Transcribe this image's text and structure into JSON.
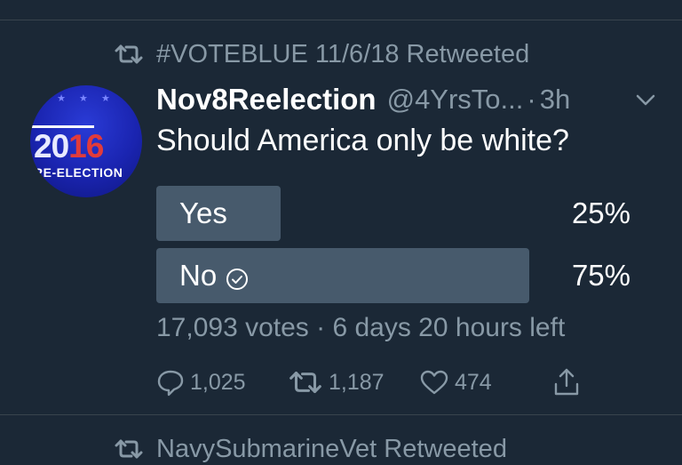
{
  "retweet_context": "#VOTEBLUE 11/6/18 Retweeted",
  "tweet": {
    "author_name": "Nov8Reelection",
    "handle": "@4YrsTo...",
    "separator": "·",
    "time": "3h",
    "text": "Should America only be white?",
    "avatar": {
      "year_part1": "20",
      "year_part2": "16",
      "subtitle": "RE-ELECTION"
    }
  },
  "poll": {
    "options": [
      {
        "label": "Yes",
        "percent_text": "25%",
        "percent": 25,
        "selected": false
      },
      {
        "label": "No",
        "percent_text": "75%",
        "percent": 75,
        "selected": true
      }
    ],
    "meta": "17,093 votes · 6 days 20 hours left"
  },
  "actions": {
    "replies": "1,025",
    "retweets": "1,187",
    "likes": "474"
  },
  "next_retweet_context": "NavySubmarineVet Retweeted",
  "colors": {
    "background": "#1b2836",
    "secondary_text": "#8899a6",
    "poll_bar": "#475a6c",
    "divider": "#38444d"
  },
  "icons": [
    "retweet-icon",
    "chevron-down-icon",
    "check-circle-icon",
    "reply-icon",
    "like-icon",
    "share-icon"
  ]
}
